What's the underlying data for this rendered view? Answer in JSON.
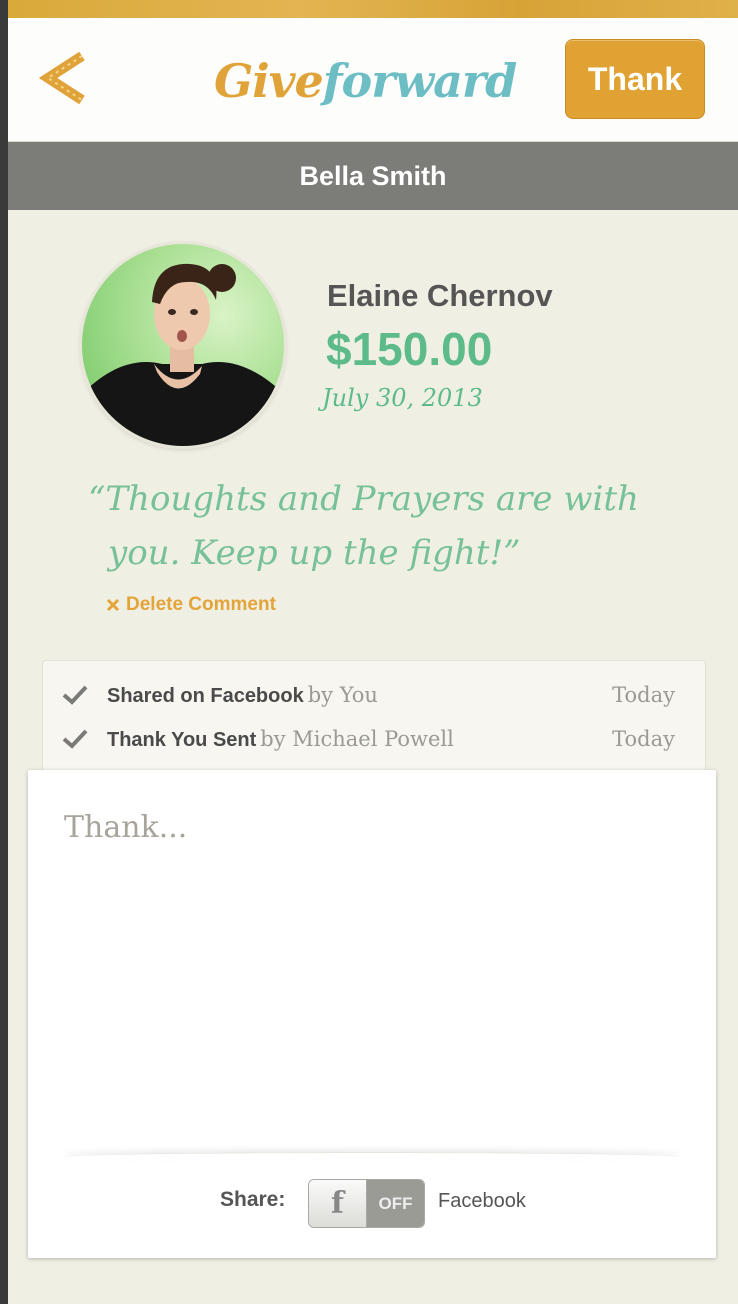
{
  "header": {
    "logo_part1": "Give",
    "logo_part2": "forward",
    "thank_button": "Thank"
  },
  "recipient": {
    "name": "Bella Smith"
  },
  "donation": {
    "donor_name": "Elaine Chernov",
    "amount": "$150.00",
    "date": "July 30, 2013",
    "quote_line1": "“Thoughts and Prayers are with",
    "quote_line2": "you. Keep up the fight!”",
    "delete_label": "Delete Comment"
  },
  "activity": [
    {
      "action": "Shared on Facebook",
      "by": "by You",
      "time": "Today"
    },
    {
      "action": "Thank You Sent",
      "by": "by Michael Powell",
      "time": "Today"
    }
  ],
  "compose": {
    "placeholder": "Thank...",
    "share_label": "Share:",
    "toggle_icon": "f",
    "toggle_state": "OFF",
    "share_target": "Facebook"
  },
  "colors": {
    "accent_orange": "#e1a234",
    "logo_teal": "#6cbec4",
    "money_green": "#5dbb8a",
    "subheader_gray": "#7c7c78",
    "background": "#f0efe4"
  }
}
